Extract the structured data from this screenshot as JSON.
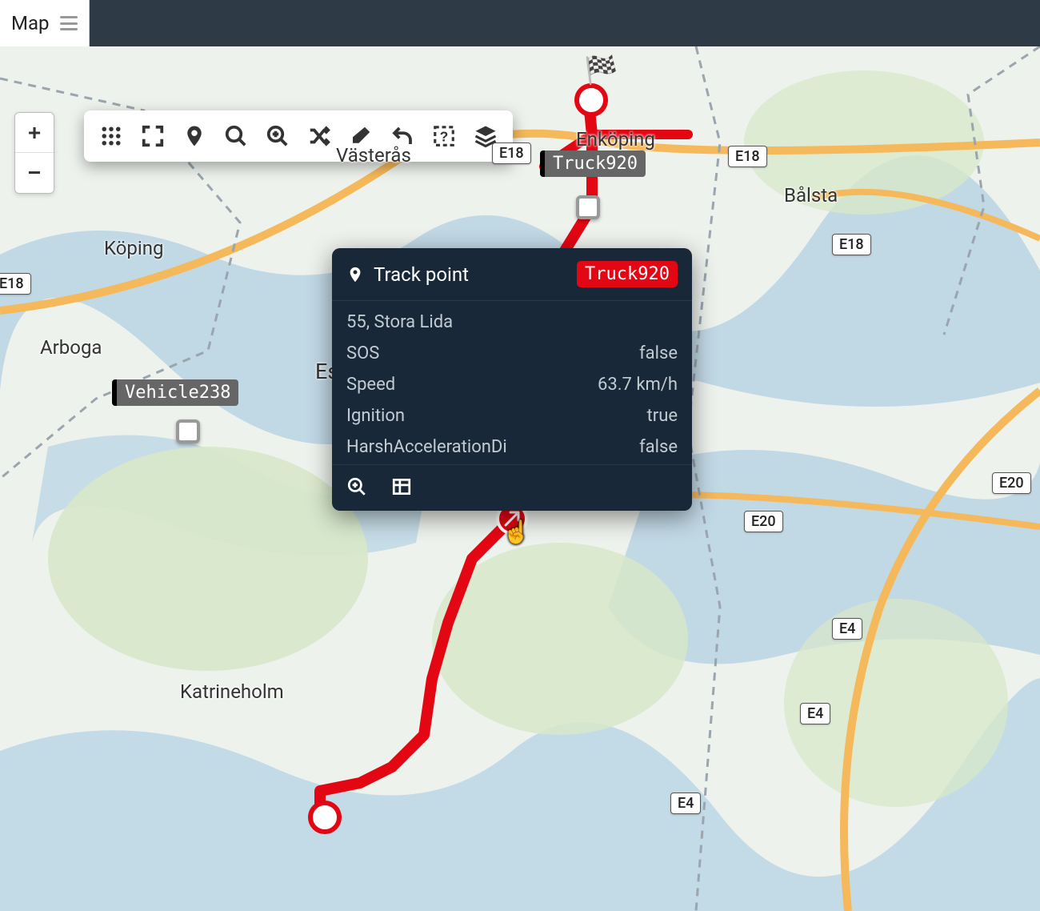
{
  "header": {
    "map_menu_label": "Map"
  },
  "zoom": {
    "in": "+",
    "out": "−"
  },
  "vehicles": {
    "truck": {
      "label": "Truck920"
    },
    "vehicle": {
      "label": "Vehicle238"
    }
  },
  "popup": {
    "title": "Track point",
    "badge": "Truck920",
    "address": "55, Stora Lida",
    "rows": [
      {
        "k": "SOS",
        "v": "false"
      },
      {
        "k": "Speed",
        "v": "63.7 km/h"
      },
      {
        "k": "Ignition",
        "v": "true"
      },
      {
        "k": "HarshAccelerationDi",
        "v": "false"
      }
    ]
  },
  "road_signs": [
    "E18",
    "E18",
    "E18",
    "E18",
    "E20",
    "E20",
    "E4",
    "E4",
    "E4"
  ],
  "cities": [
    "Västerås",
    "Enköping",
    "Bålsta",
    "Köping",
    "Arboga",
    "Eskilstuna",
    "Katrineholm"
  ],
  "toolbar_icons": [
    "grid",
    "fullscreen",
    "pin",
    "search",
    "zoom-in-tool",
    "shuffle",
    "eraser",
    "undo",
    "select-help",
    "layers"
  ]
}
